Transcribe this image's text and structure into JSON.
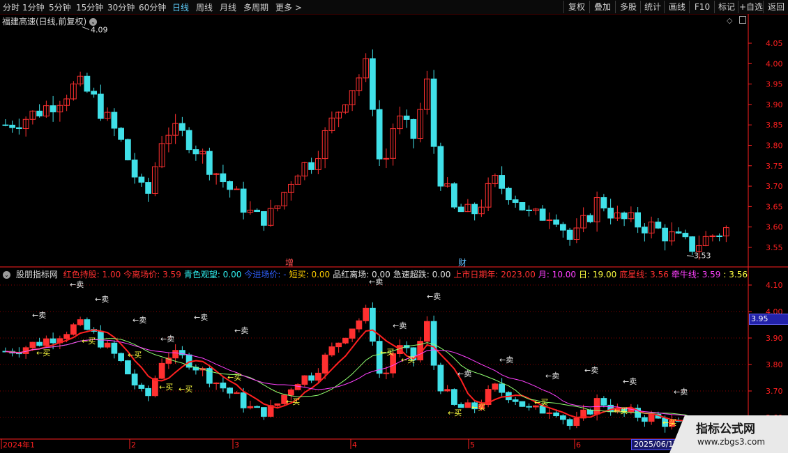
{
  "toolbar": {
    "periods": [
      "分时",
      "1分钟",
      "5分钟",
      "15分钟",
      "30分钟",
      "60分钟",
      "日线",
      "周线",
      "月线",
      "多周期",
      "更多 >"
    ],
    "active": "日线",
    "right_buttons": [
      "复权",
      "叠加",
      "多股",
      "统计",
      "画线",
      "F10",
      "标记",
      "+自选",
      "返回"
    ]
  },
  "main_panel": {
    "title": "福建高速(日线,前复权)",
    "high_label": "4.09",
    "low_label": "3.53",
    "marker_zeng": "增",
    "marker_cai": "财",
    "y_ticks": [
      "4.05",
      "4.00",
      "3.95",
      "3.90",
      "3.85",
      "3.80",
      "3.75",
      "3.70",
      "3.65",
      "3.60",
      "3.55"
    ]
  },
  "indicator_panel": {
    "name": "股朋指标网",
    "items": [
      {
        "label": "红色持股: 1.00",
        "color": "#ff3030"
      },
      {
        "label": "今离场价: 3.59",
        "color": "#ff3030"
      },
      {
        "label": "青色观望: 0.00",
        "color": "#30f0f0"
      },
      {
        "label": "今进场价: -",
        "color": "#3060ff"
      },
      {
        "label": "短买: 0.00",
        "color": "#ffd000"
      },
      {
        "label": "品红离场: 0.00",
        "color": "#e0e0e0"
      },
      {
        "label": "急速超跌: 0.00",
        "color": "#e0e0e0"
      },
      {
        "label": "上市日期年: 2023.00",
        "color": "#ff3030"
      },
      {
        "label": "月: 10.00",
        "color": "#ff40ff"
      },
      {
        "label": "日: 19.00",
        "color": "#ffff40"
      },
      {
        "label": "底星线: 3.56",
        "color": "#ff3030"
      },
      {
        "label": "牵牛线: 3.59",
        "color": "#ff40ff"
      },
      {
        "label": ": 3.56",
        "color": "#ffff40"
      },
      {
        "label": ": 3.56",
        "color": "#ff3030"
      },
      {
        "label": ": 3.5",
        "color": "#ff3030"
      }
    ],
    "y_ticks": [
      "4.10",
      "4.00",
      "3.90",
      "3.80",
      "3.70",
      "3.60"
    ],
    "current_price": "3.95",
    "buy_label": "买",
    "sell_label": "卖"
  },
  "x_axis": {
    "labels": [
      "2024年1",
      "2",
      "3",
      "4",
      "5",
      "6"
    ],
    "hover_date": "2025/06/17"
  },
  "watermark": {
    "title": "指标公式网",
    "url": "www.zbgs3.com"
  },
  "colors": {
    "up": "#ff3030",
    "down": "#40e0e8",
    "grid": "#8b0000",
    "axis": "#ff2020"
  }
}
